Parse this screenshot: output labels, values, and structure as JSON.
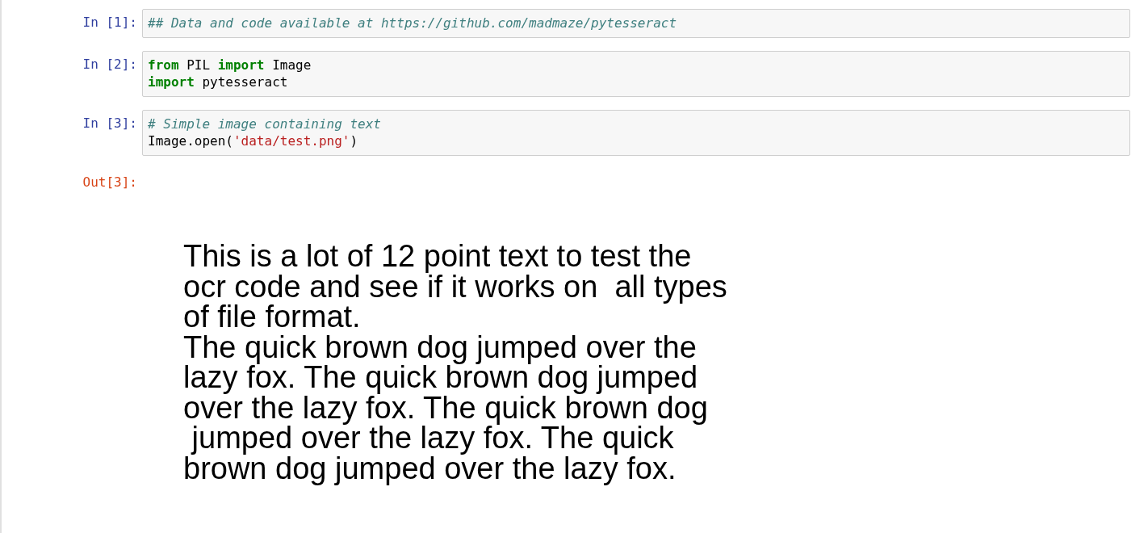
{
  "cells": [
    {
      "prompt": "In [1]:",
      "lines": [
        [
          {
            "kind": "comment",
            "text": "## Data and code available at https://github.com/madmaze/pytesseract"
          }
        ]
      ]
    },
    {
      "prompt": "In [2]:",
      "lines": [
        [
          {
            "kind": "keyword",
            "text": "from"
          },
          {
            "kind": "plain",
            "text": " PIL "
          },
          {
            "kind": "keyword",
            "text": "import"
          },
          {
            "kind": "plain",
            "text": " Image"
          }
        ],
        [
          {
            "kind": "keyword",
            "text": "import"
          },
          {
            "kind": "plain",
            "text": " pytesseract"
          }
        ]
      ]
    },
    {
      "prompt": "In [3]:",
      "lines": [
        [
          {
            "kind": "comment",
            "text": "# Simple image containing text"
          }
        ],
        [
          {
            "kind": "plain",
            "text": "Image.open("
          },
          {
            "kind": "string",
            "text": "'data/test.png'"
          },
          {
            "kind": "plain",
            "text": ")"
          }
        ]
      ]
    }
  ],
  "output": {
    "prompt": "Out[3]:",
    "image_lines": [
      "This is a lot of 12 point text to test the",
      "ocr code and see if it works on  all types",
      "of file format.",
      "The quick brown dog jumped over the",
      "lazy fox. The quick brown dog jumped",
      "over the lazy fox. The quick brown dog",
      " jumped over the lazy fox. The quick",
      "brown dog jumped over the lazy fox."
    ]
  }
}
